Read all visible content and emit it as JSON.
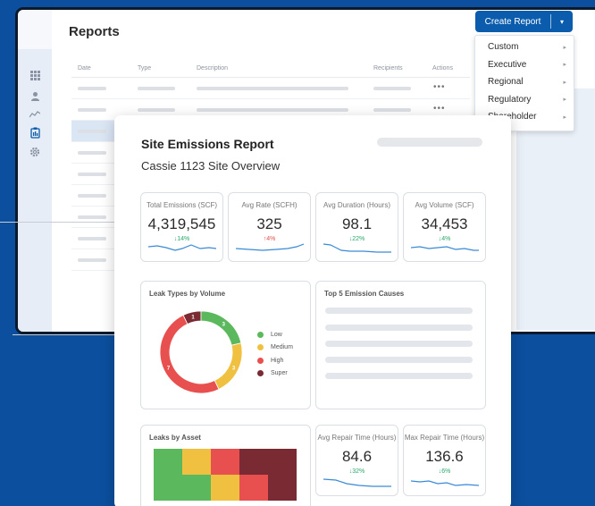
{
  "page": {
    "title": "Reports"
  },
  "create_button": {
    "label": "Create Report",
    "caret": "▾"
  },
  "dropdown": {
    "items": [
      {
        "label": "Custom"
      },
      {
        "label": "Executive"
      },
      {
        "label": "Regional"
      },
      {
        "label": "Regulatory"
      },
      {
        "label": "Shareholder"
      }
    ],
    "arrow": "▸"
  },
  "table": {
    "columns": [
      "Date",
      "Type",
      "Description",
      "Recipients",
      "Actions"
    ],
    "action_glyph": "•••"
  },
  "card": {
    "title": "Site Emissions Report",
    "subtitle": "Cassie 1123 Site Overview",
    "kpis": [
      {
        "label": "Total Emissions (SCF)",
        "value": "4,319,545",
        "change": "↓14%",
        "direction": "down"
      },
      {
        "label": "Avg Rate (SCFH)",
        "value": "325",
        "change": "↑4%",
        "direction": "up"
      },
      {
        "label": "Avg Duration (Hours)",
        "value": "98.1",
        "change": "↓22%",
        "direction": "down"
      },
      {
        "label": "Avg Volume (SCF)",
        "value": "34,453",
        "change": "↓4%",
        "direction": "down"
      }
    ],
    "leak_types": {
      "title": "Leak Types by Volume",
      "legend": [
        {
          "label": "Low",
          "color": "#5cb85c"
        },
        {
          "label": "Medium",
          "color": "#f0c040"
        },
        {
          "label": "High",
          "color": "#e8504f"
        },
        {
          "label": "Super",
          "color": "#7a2a33"
        }
      ]
    },
    "top_causes": {
      "title": "Top 5 Emission Causes"
    },
    "leaks_by_asset": {
      "title": "Leaks by Asset"
    },
    "repair": [
      {
        "label": "Avg Repair Time (Hours)",
        "value": "84.6",
        "change": "↓32%",
        "direction": "down"
      },
      {
        "label": "Max Repair Time (Hours)",
        "value": "136.6",
        "change": "↓6%",
        "direction": "down"
      }
    ]
  },
  "chart_data": {
    "type": "pie",
    "title": "Leak Types by Volume",
    "categories": [
      "Low",
      "Medium",
      "High",
      "Super"
    ],
    "values": [
      3,
      3,
      7,
      1
    ],
    "colors": [
      "#5cb85c",
      "#f0c040",
      "#e8504f",
      "#7a2a33"
    ]
  },
  "heatmap_data": {
    "type": "heatmap",
    "title": "Leaks by Asset",
    "rows": [
      [
        "#5cb85c",
        "#f0c040",
        "#e8504f",
        "#7a2a33",
        "#7a2a33"
      ],
      [
        "#5cb85c",
        "#5cb85c",
        "#f0c040",
        "#e8504f",
        "#7a2a33"
      ]
    ]
  }
}
